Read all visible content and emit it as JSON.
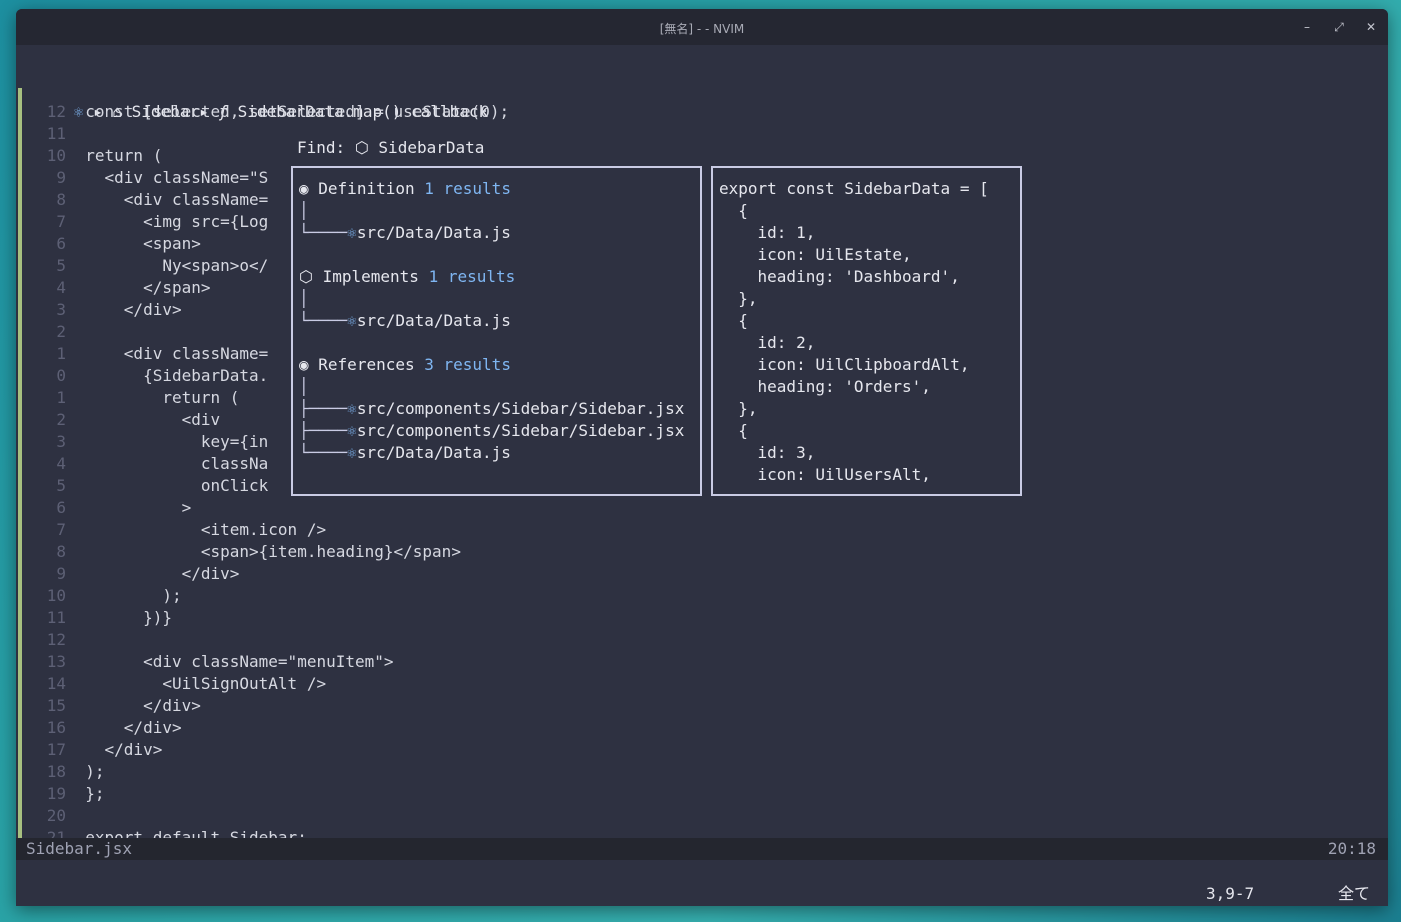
{
  "window": {
    "title": "[無名] - - NVIM",
    "controls": {
      "minimize": "–",
      "maximize": "⤢",
      "close": "✕"
    }
  },
  "breadcrumb": {
    "react_icon": "⚛",
    "component": "Sidebar",
    "func_icon": "ƒ",
    "callback": "SidebarData.map() callback"
  },
  "code_lines": [
    {
      "num": "12",
      "text": "const [selected, setSelected] = useState(0);"
    },
    {
      "num": "11",
      "text": ""
    },
    {
      "num": "10",
      "text": "return ("
    },
    {
      "num": "9",
      "text": "<div className=\"S"
    },
    {
      "num": "8",
      "text": "<div className="
    },
    {
      "num": "7",
      "text": "<img src={Log"
    },
    {
      "num": "6",
      "text": "<span>"
    },
    {
      "num": "5",
      "text": "Ny<span>o</"
    },
    {
      "num": "4",
      "text": "</span>"
    },
    {
      "num": "3",
      "text": "</div>"
    },
    {
      "num": "2",
      "text": ""
    },
    {
      "num": "1",
      "text": "<div className="
    },
    {
      "num": "0",
      "text": "{SidebarData."
    },
    {
      "num": "1",
      "text": "return ("
    },
    {
      "num": "2",
      "text": "<div"
    },
    {
      "num": "3",
      "text": "key={in"
    },
    {
      "num": "4",
      "text": "classNa"
    },
    {
      "num": "5",
      "text": "onClick"
    },
    {
      "num": "6",
      "text": ">"
    },
    {
      "num": "7",
      "text": "<item.icon />"
    },
    {
      "num": "8",
      "text": "<span>{item.heading}</span>"
    },
    {
      "num": "9",
      "text": "</div>"
    },
    {
      "num": "10",
      "text": ");"
    },
    {
      "num": "11",
      "text": "})}"
    },
    {
      "num": "12",
      "text": ""
    },
    {
      "num": "13",
      "text": "<div className=\"menuItem\">"
    },
    {
      "num": "14",
      "text": "<UilSignOutAlt />"
    },
    {
      "num": "15",
      "text": "</div>"
    },
    {
      "num": "16",
      "text": "</div>"
    },
    {
      "num": "17",
      "text": "</div>"
    },
    {
      "num": "18",
      "text": ");"
    },
    {
      "num": "19",
      "text": "};"
    },
    {
      "num": "20",
      "text": ""
    },
    {
      "num": "21",
      "text": "export default Sidebar;"
    }
  ],
  "finder": {
    "label": "Find:",
    "query": "SidebarData",
    "groups": [
      {
        "title": "Definition",
        "count": "1 results",
        "items": [
          "src/Data/Data.js"
        ]
      },
      {
        "title": "Implements",
        "count": "1 results",
        "items": [
          "src/Data/Data.js"
        ]
      },
      {
        "title": "References",
        "count": "3 results",
        "items": [
          "src/components/Sidebar/Sidebar.jsx",
          "src/components/Sidebar/Sidebar.jsx",
          "src/Data/Data.js"
        ]
      }
    ]
  },
  "preview": [
    "export const SidebarData = [",
    "  {",
    "    id: 1,",
    "    icon: UilEstate,",
    "    heading: 'Dashboard',",
    "  },",
    "  {",
    "    id: 2,",
    "    icon: UilClipboardAlt,",
    "    heading: 'Orders',",
    "  },",
    "  {",
    "    id: 3,",
    "    icon: UilUsersAlt,"
  ],
  "status": {
    "filename": "Sidebar.jsx",
    "position": "20:18"
  },
  "cmdline": {
    "ruler": "3,9-7",
    "scroll": "全て"
  }
}
